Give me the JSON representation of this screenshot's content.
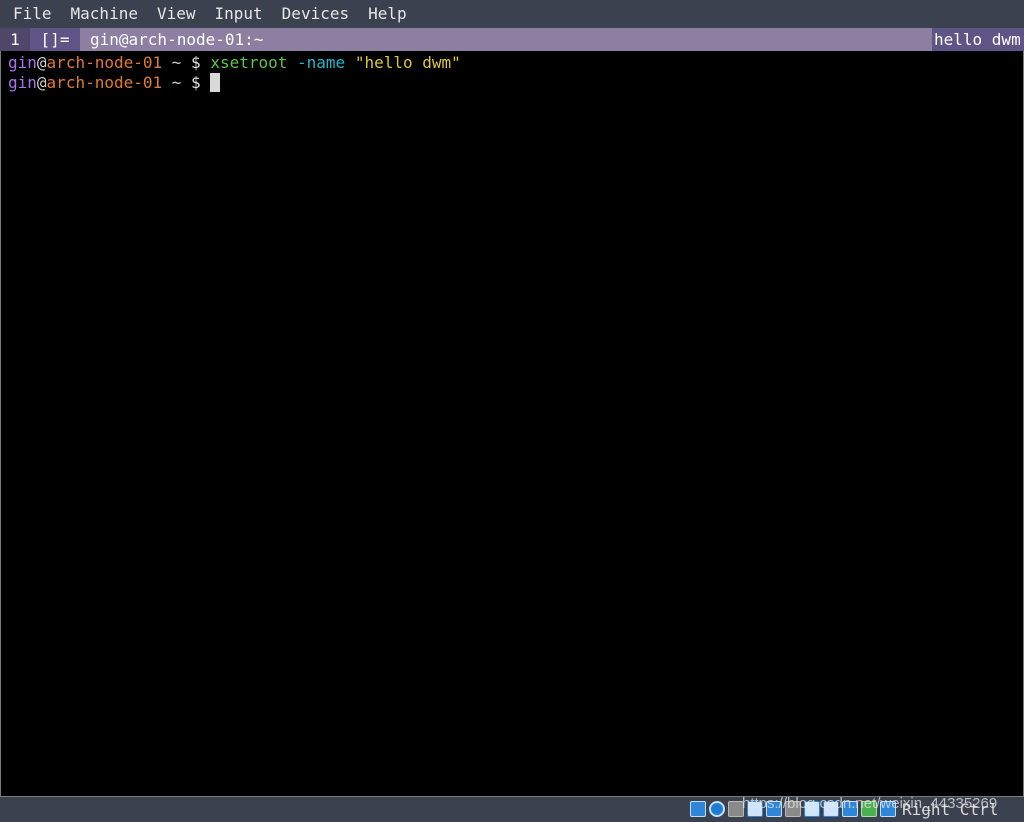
{
  "menubar": {
    "items": [
      "File",
      "Machine",
      "View",
      "Input",
      "Devices",
      "Help"
    ]
  },
  "dwm": {
    "tag": "1",
    "layout": "[]=",
    "window_title": "gin@arch-node-01:~",
    "status_text": "hello dwm"
  },
  "terminal": {
    "line1": {
      "user": "gin",
      "at": "@",
      "host": "arch-node-01",
      "cwd": " ~ ",
      "dollar": "$ ",
      "command": "xsetroot",
      "flag": " -name ",
      "argument": "\"hello dwm\""
    },
    "line2": {
      "user": "gin",
      "at": "@",
      "host": "arch-node-01",
      "cwd": " ~ ",
      "dollar": "$ "
    }
  },
  "statusbar": {
    "icons": [
      "hard-disk-icon",
      "optical-disc-icon",
      "audio-icon",
      "network-icon",
      "usb-icon",
      "shared-folders-icon",
      "display-icon",
      "video-capture-icon",
      "virtualization-icon",
      "mouse-integration-icon",
      "keyboard-capture-icon"
    ],
    "host_key": "Right Ctrl",
    "watermark": "https://blog.csdn.net/weixin_44335269"
  },
  "colors": {
    "menubar_bg": "#3c4150",
    "dwm_bar_bg": "#8c7fa1",
    "dwm_selected": "#5e5586",
    "terminal_bg": "#000000",
    "prompt_user": "#a774ec",
    "prompt_host": "#e07a34",
    "command": "#5ec24f",
    "flag": "#27b6c9",
    "string": "#d9c63c"
  }
}
